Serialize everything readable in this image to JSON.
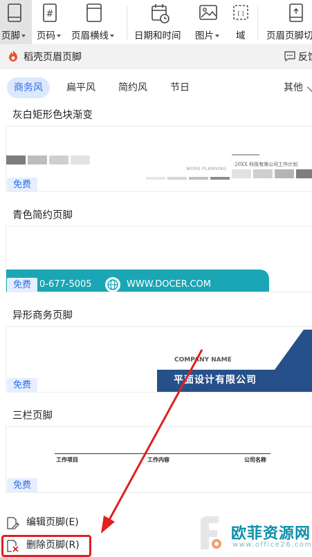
{
  "ribbon": {
    "items": [
      {
        "label": "页脚",
        "icon": "page-footer-icon",
        "dropdown": true
      },
      {
        "label": "页码",
        "icon": "page-number-icon",
        "dropdown": true
      },
      {
        "label": "页眉横线",
        "icon": "header-line-icon",
        "dropdown": true
      },
      {
        "label": "日期和时间",
        "icon": "calendar-clock-icon",
        "dropdown": false
      },
      {
        "label": "图片",
        "icon": "image-icon",
        "dropdown": true
      },
      {
        "label": "域",
        "icon": "field-icon",
        "dropdown": false
      },
      {
        "label": "页眉页脚切",
        "icon": "header-footer-switch-icon",
        "dropdown": false
      }
    ]
  },
  "panel": {
    "title": "稻壳页眉页脚",
    "feedback": "反馈"
  },
  "tabs": {
    "items": [
      "商务风",
      "扁平风",
      "简约风",
      "节日"
    ],
    "active": "商务风",
    "more": "其他"
  },
  "templates": [
    {
      "title": "灰白矩形色块渐变",
      "badge": "免费",
      "preview": {
        "small_text_1": "WORK PLANNING",
        "small_text_2": "20XX 科技有限公司工作计划"
      }
    },
    {
      "title": "青色简约页脚",
      "badge": "免费",
      "preview": {
        "phone": "0-677-5005",
        "url": "WWW.DOCER.COM"
      }
    },
    {
      "title": "异形商务页脚",
      "badge": "免费",
      "preview": {
        "company_en": "COMPANY NAME",
        "company_cn": "平面设计有限公司"
      }
    },
    {
      "title": "三栏页脚",
      "badge": "免费",
      "preview": {
        "col1": "工作项目",
        "col2": "工作内容",
        "col3": "公司名称"
      }
    }
  ],
  "menu": {
    "edit": "编辑页脚(E)",
    "delete": "删除页脚(R)"
  },
  "watermark": {
    "name": "欧菲资源网",
    "url": "www.office26.com"
  },
  "colors": {
    "accent": "#2f6fe4",
    "tab_active_bg": "#dbe8ff",
    "teal": "#1aa6b4",
    "navy": "#26508a",
    "highlight_red": "#e01f1f",
    "brand_orange": "#e8552c"
  }
}
